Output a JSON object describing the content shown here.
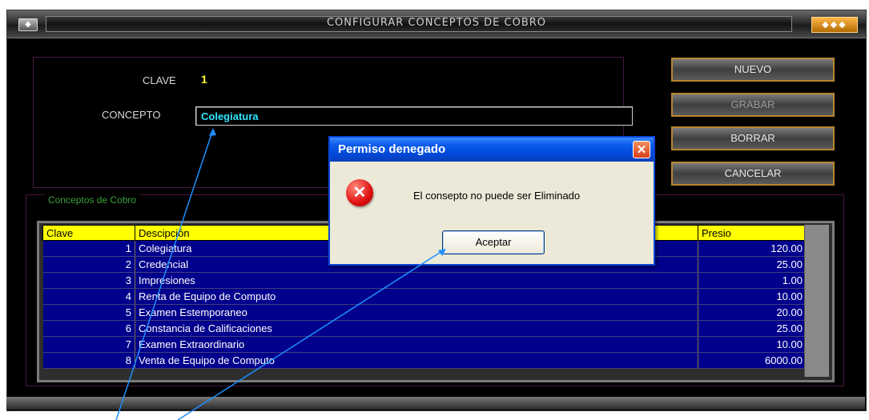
{
  "window": {
    "title": "CONFIGURAR CONCEPTOS DE COBRO",
    "system_icon": "window-menu-icon",
    "controls_icon": "window-controls-icon"
  },
  "form": {
    "clave_label": "CLAVE",
    "clave_value": "1",
    "concepto_label": "CONCEPTO",
    "concepto_value": "Colegiatura"
  },
  "buttons": {
    "nuevo": "NUEVO",
    "grabar": "GRABAR",
    "borrar": "BORRAR",
    "cancelar": "CANCELAR"
  },
  "group": {
    "legend": "Conceptos de Cobro"
  },
  "grid": {
    "columns": [
      "Clave",
      "Descipción",
      "Presio"
    ],
    "rows": [
      {
        "clave": "1",
        "descripcion": "Colegiatura",
        "precio": "120.00"
      },
      {
        "clave": "2",
        "descripcion": "Credencial",
        "precio": "25.00"
      },
      {
        "clave": "3",
        "descripcion": "Impresiones",
        "precio": "1.00"
      },
      {
        "clave": "4",
        "descripcion": "Renta de Equipo de Computo",
        "precio": "10.00"
      },
      {
        "clave": "5",
        "descripcion": "Examen Estemporaneo",
        "precio": "20.00"
      },
      {
        "clave": "6",
        "descripcion": "Constancia de Calificaciones",
        "precio": "25.00"
      },
      {
        "clave": "7",
        "descripcion": "Examen Extraordinario",
        "precio": "10.00"
      },
      {
        "clave": "8",
        "descripcion": "Venta de Equipo de Computo",
        "precio": "6000.00"
      }
    ]
  },
  "dialog": {
    "title": "Permiso denegado",
    "message": "El consepto no puede ser Eliminado",
    "ok": "Aceptar",
    "close_icon": "close-icon",
    "error_icon": "error-icon"
  },
  "colors": {
    "header_yellow": "#ffff00",
    "grid_blue": "#00008c",
    "dialog_title_blue": "#0a5cea",
    "button_border": "#b8862e",
    "concepto_text": "#2fe8ff"
  }
}
